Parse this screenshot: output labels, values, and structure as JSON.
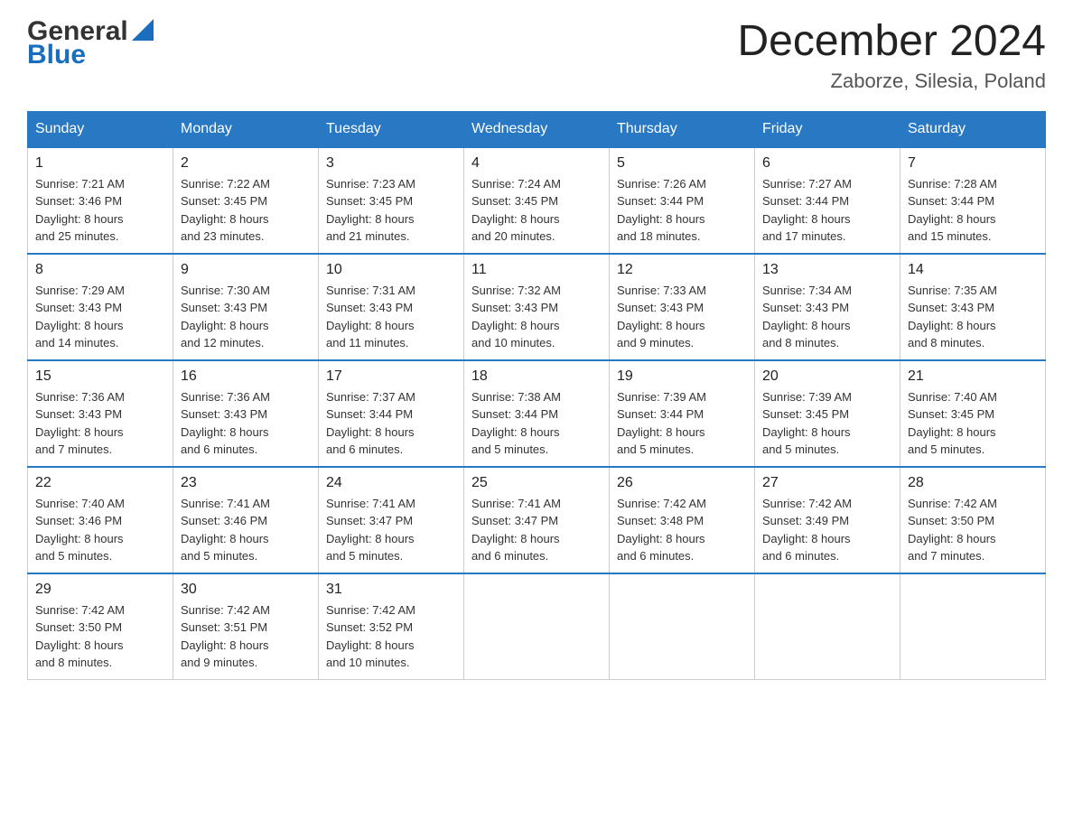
{
  "header": {
    "logo_general": "General",
    "logo_blue": "Blue",
    "month_title": "December 2024",
    "location": "Zaborze, Silesia, Poland"
  },
  "weekdays": [
    "Sunday",
    "Monday",
    "Tuesday",
    "Wednesday",
    "Thursday",
    "Friday",
    "Saturday"
  ],
  "weeks": [
    [
      {
        "day": "1",
        "sunrise": "Sunrise: 7:21 AM",
        "sunset": "Sunset: 3:46 PM",
        "daylight": "Daylight: 8 hours",
        "daylight2": "and 25 minutes."
      },
      {
        "day": "2",
        "sunrise": "Sunrise: 7:22 AM",
        "sunset": "Sunset: 3:45 PM",
        "daylight": "Daylight: 8 hours",
        "daylight2": "and 23 minutes."
      },
      {
        "day": "3",
        "sunrise": "Sunrise: 7:23 AM",
        "sunset": "Sunset: 3:45 PM",
        "daylight": "Daylight: 8 hours",
        "daylight2": "and 21 minutes."
      },
      {
        "day": "4",
        "sunrise": "Sunrise: 7:24 AM",
        "sunset": "Sunset: 3:45 PM",
        "daylight": "Daylight: 8 hours",
        "daylight2": "and 20 minutes."
      },
      {
        "day": "5",
        "sunrise": "Sunrise: 7:26 AM",
        "sunset": "Sunset: 3:44 PM",
        "daylight": "Daylight: 8 hours",
        "daylight2": "and 18 minutes."
      },
      {
        "day": "6",
        "sunrise": "Sunrise: 7:27 AM",
        "sunset": "Sunset: 3:44 PM",
        "daylight": "Daylight: 8 hours",
        "daylight2": "and 17 minutes."
      },
      {
        "day": "7",
        "sunrise": "Sunrise: 7:28 AM",
        "sunset": "Sunset: 3:44 PM",
        "daylight": "Daylight: 8 hours",
        "daylight2": "and 15 minutes."
      }
    ],
    [
      {
        "day": "8",
        "sunrise": "Sunrise: 7:29 AM",
        "sunset": "Sunset: 3:43 PM",
        "daylight": "Daylight: 8 hours",
        "daylight2": "and 14 minutes."
      },
      {
        "day": "9",
        "sunrise": "Sunrise: 7:30 AM",
        "sunset": "Sunset: 3:43 PM",
        "daylight": "Daylight: 8 hours",
        "daylight2": "and 12 minutes."
      },
      {
        "day": "10",
        "sunrise": "Sunrise: 7:31 AM",
        "sunset": "Sunset: 3:43 PM",
        "daylight": "Daylight: 8 hours",
        "daylight2": "and 11 minutes."
      },
      {
        "day": "11",
        "sunrise": "Sunrise: 7:32 AM",
        "sunset": "Sunset: 3:43 PM",
        "daylight": "Daylight: 8 hours",
        "daylight2": "and 10 minutes."
      },
      {
        "day": "12",
        "sunrise": "Sunrise: 7:33 AM",
        "sunset": "Sunset: 3:43 PM",
        "daylight": "Daylight: 8 hours",
        "daylight2": "and 9 minutes."
      },
      {
        "day": "13",
        "sunrise": "Sunrise: 7:34 AM",
        "sunset": "Sunset: 3:43 PM",
        "daylight": "Daylight: 8 hours",
        "daylight2": "and 8 minutes."
      },
      {
        "day": "14",
        "sunrise": "Sunrise: 7:35 AM",
        "sunset": "Sunset: 3:43 PM",
        "daylight": "Daylight: 8 hours",
        "daylight2": "and 8 minutes."
      }
    ],
    [
      {
        "day": "15",
        "sunrise": "Sunrise: 7:36 AM",
        "sunset": "Sunset: 3:43 PM",
        "daylight": "Daylight: 8 hours",
        "daylight2": "and 7 minutes."
      },
      {
        "day": "16",
        "sunrise": "Sunrise: 7:36 AM",
        "sunset": "Sunset: 3:43 PM",
        "daylight": "Daylight: 8 hours",
        "daylight2": "and 6 minutes."
      },
      {
        "day": "17",
        "sunrise": "Sunrise: 7:37 AM",
        "sunset": "Sunset: 3:44 PM",
        "daylight": "Daylight: 8 hours",
        "daylight2": "and 6 minutes."
      },
      {
        "day": "18",
        "sunrise": "Sunrise: 7:38 AM",
        "sunset": "Sunset: 3:44 PM",
        "daylight": "Daylight: 8 hours",
        "daylight2": "and 5 minutes."
      },
      {
        "day": "19",
        "sunrise": "Sunrise: 7:39 AM",
        "sunset": "Sunset: 3:44 PM",
        "daylight": "Daylight: 8 hours",
        "daylight2": "and 5 minutes."
      },
      {
        "day": "20",
        "sunrise": "Sunrise: 7:39 AM",
        "sunset": "Sunset: 3:45 PM",
        "daylight": "Daylight: 8 hours",
        "daylight2": "and 5 minutes."
      },
      {
        "day": "21",
        "sunrise": "Sunrise: 7:40 AM",
        "sunset": "Sunset: 3:45 PM",
        "daylight": "Daylight: 8 hours",
        "daylight2": "and 5 minutes."
      }
    ],
    [
      {
        "day": "22",
        "sunrise": "Sunrise: 7:40 AM",
        "sunset": "Sunset: 3:46 PM",
        "daylight": "Daylight: 8 hours",
        "daylight2": "and 5 minutes."
      },
      {
        "day": "23",
        "sunrise": "Sunrise: 7:41 AM",
        "sunset": "Sunset: 3:46 PM",
        "daylight": "Daylight: 8 hours",
        "daylight2": "and 5 minutes."
      },
      {
        "day": "24",
        "sunrise": "Sunrise: 7:41 AM",
        "sunset": "Sunset: 3:47 PM",
        "daylight": "Daylight: 8 hours",
        "daylight2": "and 5 minutes."
      },
      {
        "day": "25",
        "sunrise": "Sunrise: 7:41 AM",
        "sunset": "Sunset: 3:47 PM",
        "daylight": "Daylight: 8 hours",
        "daylight2": "and 6 minutes."
      },
      {
        "day": "26",
        "sunrise": "Sunrise: 7:42 AM",
        "sunset": "Sunset: 3:48 PM",
        "daylight": "Daylight: 8 hours",
        "daylight2": "and 6 minutes."
      },
      {
        "day": "27",
        "sunrise": "Sunrise: 7:42 AM",
        "sunset": "Sunset: 3:49 PM",
        "daylight": "Daylight: 8 hours",
        "daylight2": "and 6 minutes."
      },
      {
        "day": "28",
        "sunrise": "Sunrise: 7:42 AM",
        "sunset": "Sunset: 3:50 PM",
        "daylight": "Daylight: 8 hours",
        "daylight2": "and 7 minutes."
      }
    ],
    [
      {
        "day": "29",
        "sunrise": "Sunrise: 7:42 AM",
        "sunset": "Sunset: 3:50 PM",
        "daylight": "Daylight: 8 hours",
        "daylight2": "and 8 minutes."
      },
      {
        "day": "30",
        "sunrise": "Sunrise: 7:42 AM",
        "sunset": "Sunset: 3:51 PM",
        "daylight": "Daylight: 8 hours",
        "daylight2": "and 9 minutes."
      },
      {
        "day": "31",
        "sunrise": "Sunrise: 7:42 AM",
        "sunset": "Sunset: 3:52 PM",
        "daylight": "Daylight: 8 hours",
        "daylight2": "and 10 minutes."
      },
      null,
      null,
      null,
      null
    ]
  ]
}
